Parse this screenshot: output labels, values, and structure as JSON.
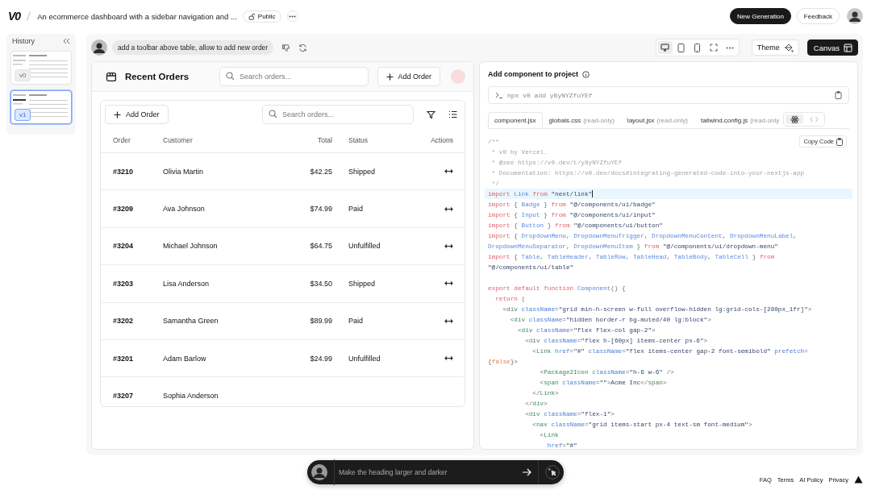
{
  "top_bar": {
    "logo": "V0",
    "title": "An ecommerce dashboard with a sidebar navigation and ...",
    "visibility": "Public",
    "new_button": "New Generation",
    "feedback_button": "Feedback"
  },
  "history": {
    "title": "History",
    "versions": [
      {
        "label": "v0",
        "selected": false
      },
      {
        "label": "v1",
        "selected": true
      }
    ]
  },
  "chat": {
    "prompt": "add a toolbar above table, allow to add new order"
  },
  "toolbar": {
    "view_modes": [
      {
        "kind": "desktop",
        "selected": true
      },
      {
        "kind": "tablet",
        "selected": false
      },
      {
        "kind": "phone",
        "selected": false
      },
      {
        "kind": "fullscreen",
        "selected": false
      },
      {
        "kind": "more",
        "selected": false
      }
    ],
    "theme_button": "Theme",
    "canvas_button": "Canvas"
  },
  "preview": {
    "title": "Recent Orders",
    "search_placeholder": "Search orders...",
    "add_button": "Add Order",
    "card": {
      "add_button": "Add Order",
      "search_placeholder": "Search orders...",
      "columns": [
        "Order",
        "Customer",
        "Total",
        "Status",
        "Actions"
      ],
      "rows": [
        {
          "order": "#3210",
          "customer": "Olivia Martin",
          "total": "$42.25",
          "status": "Shipped",
          "actions": true
        },
        {
          "order": "#3209",
          "customer": "Ava Johnson",
          "total": "$74.99",
          "status": "Paid",
          "actions": true
        },
        {
          "order": "#3204",
          "customer": "Michael Johnson",
          "total": "$64.75",
          "status": "Unfulfilled",
          "actions": true
        },
        {
          "order": "#3203",
          "customer": "Lisa Anderson",
          "total": "$34.50",
          "status": "Shipped",
          "actions": true
        },
        {
          "order": "#3202",
          "customer": "Samantha Green",
          "total": "$89.99",
          "status": "Paid",
          "actions": true
        },
        {
          "order": "#3201",
          "customer": "Adam Barlow",
          "total": "$24.99",
          "status": "Unfulfilled",
          "actions": true
        },
        {
          "order": "#3207",
          "customer": "Sophia Anderson",
          "actions": false
        }
      ]
    }
  },
  "code_panel": {
    "title": "Add component to project",
    "command": "npx v0 add y8yNYZfuYEf",
    "tabs": [
      {
        "label": "component.jsx",
        "selected": true
      },
      {
        "label": "globals.css",
        "note": "(read-only)",
        "selected": false
      },
      {
        "label": "layout.jsx",
        "note": "(read-only)",
        "selected": false
      },
      {
        "label": "tailwind.config.js",
        "note": "(read-only",
        "selected": false
      }
    ],
    "toggle": [
      {
        "kind": "react",
        "selected": true
      },
      {
        "kind": "code",
        "selected": false
      }
    ],
    "copy_button": "Copy Code",
    "lines": [
      {
        "highlighted": false,
        "tokens": [
          {
            "kind": "c",
            "text": "/**"
          }
        ]
      },
      {
        "highlighted": false,
        "tokens": [
          {
            "kind": "c",
            "text": " * v0 by Vercel."
          }
        ]
      },
      {
        "highlighted": false,
        "tokens": [
          {
            "kind": "c",
            "text": " * @see https://v0.dev/t/y8yNYZfuYEf"
          }
        ]
      },
      {
        "highlighted": false,
        "tokens": [
          {
            "kind": "c",
            "text": " * Documentation: https://v0.dev/docs#integrating-generated-code-into-your-nextjs-app"
          }
        ]
      },
      {
        "highlighted": false,
        "tokens": [
          {
            "kind": "c",
            "text": " */"
          }
        ]
      },
      {
        "highlighted": true,
        "tokens": [
          {
            "kind": "k",
            "text": "import "
          },
          {
            "kind": "f",
            "text": "Link "
          },
          {
            "kind": "k",
            "text": "from "
          },
          {
            "kind": "s",
            "text": "\"next/link\""
          }
        ]
      },
      {
        "highlighted": false,
        "tokens": [
          {
            "kind": "k",
            "text": "import "
          },
          {
            "kind": "p",
            "text": "{ "
          },
          {
            "kind": "f",
            "text": "Badge "
          },
          {
            "kind": "p",
            "text": "} "
          },
          {
            "kind": "k",
            "text": "from "
          },
          {
            "kind": "s",
            "text": "\"@/components/ui/badge\""
          }
        ]
      },
      {
        "highlighted": false,
        "tokens": [
          {
            "kind": "k",
            "text": "import "
          },
          {
            "kind": "p",
            "text": "{ "
          },
          {
            "kind": "f",
            "text": "Input "
          },
          {
            "kind": "p",
            "text": "} "
          },
          {
            "kind": "k",
            "text": "from "
          },
          {
            "kind": "s",
            "text": "\"@/components/ui/input\""
          }
        ]
      },
      {
        "highlighted": false,
        "tokens": [
          {
            "kind": "k",
            "text": "import "
          },
          {
            "kind": "p",
            "text": "{ "
          },
          {
            "kind": "f",
            "text": "Button "
          },
          {
            "kind": "p",
            "text": "} "
          },
          {
            "kind": "k",
            "text": "from "
          },
          {
            "kind": "s",
            "text": "\"@/components/ui/button\""
          }
        ]
      },
      {
        "highlighted": false,
        "tokens": [
          {
            "kind": "k",
            "text": "import "
          },
          {
            "kind": "p",
            "text": "{ "
          },
          {
            "kind": "f",
            "text": "DropdownMenu"
          },
          {
            "kind": "p",
            "text": ", "
          },
          {
            "kind": "f",
            "text": "DropdownMenuTrigger"
          },
          {
            "kind": "p",
            "text": ", "
          },
          {
            "kind": "f",
            "text": "DropdownMenuContent"
          },
          {
            "kind": "p",
            "text": ", "
          },
          {
            "kind": "f",
            "text": "DropdownMenuLabel"
          },
          {
            "kind": "p",
            "text": ","
          }
        ]
      },
      {
        "highlighted": false,
        "tokens": [
          {
            "kind": "f",
            "text": "DropdownMenuSeparator"
          },
          {
            "kind": "p",
            "text": ", "
          },
          {
            "kind": "f",
            "text": "DropdownMenuItem "
          },
          {
            "kind": "p",
            "text": "} "
          },
          {
            "kind": "k",
            "text": "from "
          },
          {
            "kind": "s",
            "text": "\"@/components/ui/dropdown-menu\""
          }
        ]
      },
      {
        "highlighted": false,
        "tokens": [
          {
            "kind": "k",
            "text": "import "
          },
          {
            "kind": "p",
            "text": "{ "
          },
          {
            "kind": "f",
            "text": "Table"
          },
          {
            "kind": "p",
            "text": ", "
          },
          {
            "kind": "f",
            "text": "TableHeader"
          },
          {
            "kind": "p",
            "text": ", "
          },
          {
            "kind": "f",
            "text": "TableRow"
          },
          {
            "kind": "p",
            "text": ", "
          },
          {
            "kind": "f",
            "text": "TableHead"
          },
          {
            "kind": "p",
            "text": ", "
          },
          {
            "kind": "f",
            "text": "TableBody"
          },
          {
            "kind": "p",
            "text": ", "
          },
          {
            "kind": "f",
            "text": "TableCell "
          },
          {
            "kind": "p",
            "text": "} "
          },
          {
            "kind": "k",
            "text": "from"
          }
        ]
      },
      {
        "highlighted": false,
        "tokens": [
          {
            "kind": "s",
            "text": "\"@/components/ui/table\""
          }
        ]
      },
      {
        "highlighted": false
      },
      {
        "highlighted": false,
        "tokens": [
          {
            "kind": "k",
            "text": "export default function "
          },
          {
            "kind": "f",
            "text": "Component"
          },
          {
            "kind": "p",
            "text": "() {"
          }
        ]
      },
      {
        "highlighted": false,
        "tokens": [
          {
            "kind": "k",
            "text": "  return "
          },
          {
            "kind": "p",
            "text": "("
          }
        ]
      },
      {
        "highlighted": false,
        "tokens": [
          {
            "kind": "p",
            "text": "    <"
          },
          {
            "kind": "t",
            "text": "div "
          },
          {
            "kind": "a",
            "text": "className"
          },
          {
            "kind": "p",
            "text": "="
          },
          {
            "kind": "s",
            "text": "\"grid min-h-screen w-full overflow-hidden lg:grid-cols-[280px_1fr]\""
          },
          {
            "kind": "p",
            "text": ">"
          }
        ]
      },
      {
        "highlighted": false,
        "tokens": [
          {
            "kind": "p",
            "text": "      <"
          },
          {
            "kind": "t",
            "text": "div "
          },
          {
            "kind": "a",
            "text": "className"
          },
          {
            "kind": "p",
            "text": "="
          },
          {
            "kind": "s",
            "text": "\"hidden border-r bg-muted/40 lg:block\""
          },
          {
            "kind": "p",
            "text": ">"
          }
        ]
      },
      {
        "highlighted": false,
        "tokens": [
          {
            "kind": "p",
            "text": "        <"
          },
          {
            "kind": "t",
            "text": "div "
          },
          {
            "kind": "a",
            "text": "className"
          },
          {
            "kind": "p",
            "text": "="
          },
          {
            "kind": "s",
            "text": "\"flex flex-col gap-2\""
          },
          {
            "kind": "p",
            "text": ">"
          }
        ]
      },
      {
        "highlighted": false,
        "tokens": [
          {
            "kind": "p",
            "text": "          <"
          },
          {
            "kind": "t",
            "text": "div "
          },
          {
            "kind": "a",
            "text": "className"
          },
          {
            "kind": "p",
            "text": "="
          },
          {
            "kind": "s",
            "text": "\"flex h-[60px] items-center px-6\""
          },
          {
            "kind": "p",
            "text": ">"
          }
        ]
      },
      {
        "highlighted": false,
        "tokens": [
          {
            "kind": "p",
            "text": "            <"
          },
          {
            "kind": "t",
            "text": "Link "
          },
          {
            "kind": "a",
            "text": "href"
          },
          {
            "kind": "p",
            "text": "="
          },
          {
            "kind": "s",
            "text": "\"#\" "
          },
          {
            "kind": "a",
            "text": "className"
          },
          {
            "kind": "p",
            "text": "="
          },
          {
            "kind": "s",
            "text": "\"flex items-center gap-2 font-semibold\" "
          },
          {
            "kind": "a",
            "text": "prefetch="
          }
        ]
      },
      {
        "highlighted": false,
        "tokens": [
          {
            "kind": "p",
            "text": "{"
          },
          {
            "kind": "o",
            "text": "false"
          },
          {
            "kind": "p",
            "text": "}>"
          }
        ]
      },
      {
        "highlighted": false,
        "tokens": [
          {
            "kind": "p",
            "text": "              <"
          },
          {
            "kind": "t",
            "text": "Package2Icon "
          },
          {
            "kind": "a",
            "text": "className"
          },
          {
            "kind": "p",
            "text": "="
          },
          {
            "kind": "s",
            "text": "\"h-6 w-6\" "
          },
          {
            "kind": "p",
            "text": "/>"
          }
        ]
      },
      {
        "highlighted": false,
        "tokens": [
          {
            "kind": "p",
            "text": "              <"
          },
          {
            "kind": "t",
            "text": "span "
          },
          {
            "kind": "a",
            "text": "className"
          },
          {
            "kind": "p",
            "text": "="
          },
          {
            "kind": "s",
            "text": "\"\""
          },
          {
            "kind": "p",
            "text": ">"
          },
          {
            "kind": "s",
            "text": "Acme Inc"
          },
          {
            "kind": "p",
            "text": "</"
          },
          {
            "kind": "t",
            "text": "span"
          },
          {
            "kind": "p",
            "text": ">"
          }
        ]
      },
      {
        "highlighted": false,
        "tokens": [
          {
            "kind": "p",
            "text": "            </"
          },
          {
            "kind": "t",
            "text": "Link"
          },
          {
            "kind": "p",
            "text": ">"
          }
        ]
      },
      {
        "highlighted": false,
        "tokens": [
          {
            "kind": "p",
            "text": "          </"
          },
          {
            "kind": "t",
            "text": "div"
          },
          {
            "kind": "p",
            "text": ">"
          }
        ]
      },
      {
        "highlighted": false,
        "tokens": [
          {
            "kind": "p",
            "text": "          <"
          },
          {
            "kind": "t",
            "text": "div "
          },
          {
            "kind": "a",
            "text": "className"
          },
          {
            "kind": "p",
            "text": "="
          },
          {
            "kind": "s",
            "text": "\"flex-1\""
          },
          {
            "kind": "p",
            "text": ">"
          }
        ]
      },
      {
        "highlighted": false,
        "tokens": [
          {
            "kind": "p",
            "text": "            <"
          },
          {
            "kind": "t",
            "text": "nav "
          },
          {
            "kind": "a",
            "text": "className"
          },
          {
            "kind": "p",
            "text": "="
          },
          {
            "kind": "s",
            "text": "\"grid items-start px-4 text-sm font-medium\""
          },
          {
            "kind": "p",
            "text": ">"
          }
        ]
      },
      {
        "highlighted": false,
        "tokens": [
          {
            "kind": "p",
            "text": "              <"
          },
          {
            "kind": "t",
            "text": "Link"
          }
        ]
      },
      {
        "highlighted": false,
        "tokens": [
          {
            "kind": "a",
            "text": "                href"
          },
          {
            "kind": "p",
            "text": "="
          },
          {
            "kind": "s",
            "text": "\"#\""
          }
        ]
      }
    ]
  },
  "prompt_bar": {
    "placeholder": "Make the heading larger and darker"
  },
  "footer": {
    "links": [
      "FAQ",
      "Terms",
      "AI Policy",
      "Privacy"
    ]
  }
}
